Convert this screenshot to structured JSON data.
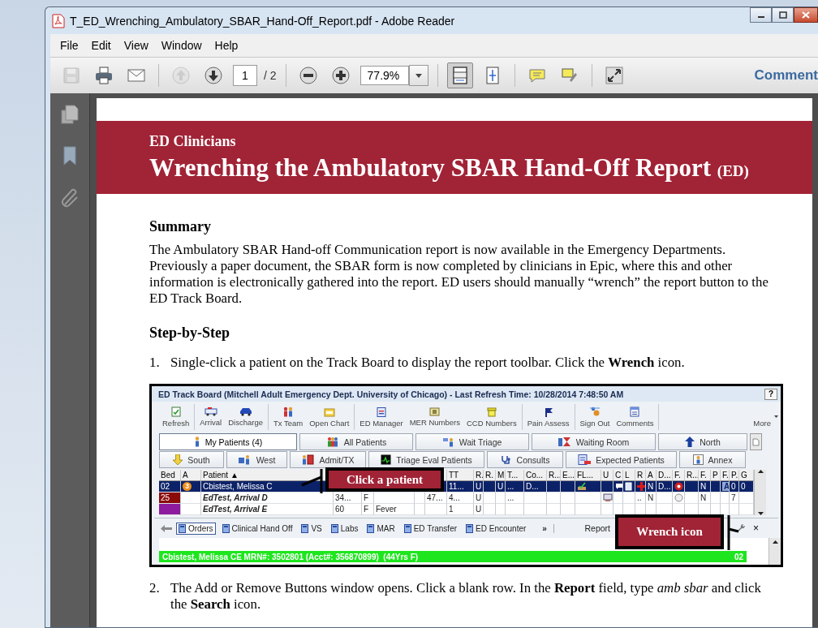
{
  "window": {
    "title": "T_ED_Wrenching_Ambulatory_SBAR_Hand-Off_Report.pdf - Adobe Reader"
  },
  "menu": [
    "File",
    "Edit",
    "View",
    "Window",
    "Help"
  ],
  "toolbar": {
    "save": {
      "disabled": true
    },
    "previous_page": {
      "disabled": true
    },
    "page": "1",
    "page_total": "/ 2",
    "zoom": "77.9%",
    "fit_page": {
      "selected": true
    },
    "fit_window": {
      "selected": false
    },
    "comment_label": "Comment"
  },
  "document": {
    "kicker": "ED Clinicians",
    "title": "Wrenching the Ambulatory SBAR Hand-Off Report",
    "title_suffix": "(ED)",
    "summary_heading": "Summary",
    "summary": "The Ambulatory SBAR Hand-off Communication report is now available in the Emergency Departments. Previously a paper document, the SBAR form is now completed by clinicians in Epic, where this and other information is electronically gathered into the report.  ED users should manually “wrench” the report button to the ED Track Board.",
    "steps_heading": "Step-by-Step",
    "steps": [
      {
        "number": "1.",
        "text": "Single-click a patient on the Track Board to display the report toolbar.  Click the **Wrench** icon.",
        "track_board": {
          "title": "ED Track Board (Mitchell Adult Emergency Dept. University of Chicago) - Last Refresh Time: 10/28/2014 7:48:50 AM",
          "help": "?",
          "toolbar_groups": [
            [
              "Refresh"
            ],
            [
              "Arrival",
              "Discharge"
            ],
            [
              "Tx Team",
              "Open Chart"
            ],
            [
              "ED Manager",
              "MER Numbers",
              "CCD Numbers"
            ],
            [
              "Pain Assess"
            ],
            [
              "Sign Out",
              "Comments"
            ]
          ],
          "more": "More",
          "tab_rows": [
            [
              {
                "label": "My Patients (4)",
                "selected": true
              },
              {
                "label": "All Patients",
                "selected": false
              },
              {
                "label": "Wait Triage",
                "selected": false
              },
              {
                "label": "Waiting Room",
                "selected": false
              },
              {
                "label": "North",
                "selected": false
              }
            ],
            [
              {
                "label": "South",
                "selected": false
              },
              {
                "label": "West",
                "selected": false
              },
              {
                "label": "Admit/TX",
                "selected": false
              },
              {
                "label": "Triage Eval Patients",
                "selected": false
              },
              {
                "label": "Consults",
                "selected": false
              },
              {
                "label": "Expected Patients",
                "selected": false
              },
              {
                "label": "Annex",
                "selected": false
              }
            ]
          ],
          "columns": [
            "Bed",
            "A",
            "Patient ▲",
            null,
            null,
            null,
            null,
            null,
            "TT",
            "R.",
            "R.",
            "M",
            "T...",
            "Co...",
            "R...",
            "E...",
            "FL...",
            "U",
            "C",
            "L",
            "R",
            "A",
            "D...",
            "F.",
            "R...",
            "F.",
            "P",
            "F.",
            "P.",
            "G"
          ],
          "rows": [
            {
              "selected": true,
              "italic": false,
              "cells": [
                "02",
                {
                  "kind": "badge",
                  "text": "3"
                },
                "Cbistest, Melissa C",
                null,
                null,
                null,
                null,
                null,
                "11...",
                "U",
                null,
                "U",
                "...",
                "D...",
                null,
                null,
                {
                  "kind": "check"
                },
                null,
                {
                  "kind": "bubble"
                },
                {
                  "kind": "note"
                },
                {
                  "kind": "cross"
                },
                "N",
                "D...",
                {
                  "kind": "alert"
                },
                null,
                "N",
                null,
                {
                  "kind": "boxed",
                  "text": "A"
                },
                "0",
                "0"
              ]
            },
            {
              "selected": false,
              "italic": true,
              "color": "#8b0a0a",
              "cells": [
                "25",
                null,
                "EdTest, Arrival D",
                "34...",
                "F",
                null,
                null,
                "47...",
                "4...",
                "U",
                null,
                null,
                "...",
                null,
                null,
                null,
                null,
                {
                  "kind": "monitor"
                },
                null,
                null,
                "..",
                "N",
                null,
                {
                  "kind": "circle"
                },
                null,
                "N",
                null,
                null,
                "7",
                null
              ]
            },
            {
              "selected": false,
              "italic": true,
              "color": "#8e1a9e",
              "cells": [
                null,
                null,
                "EdTest, Arrival E",
                "60",
                "F",
                "Fever",
                null,
                null,
                "1",
                "U",
                null,
                null,
                null,
                null,
                null,
                null,
                null,
                null,
                null,
                null,
                null,
                null,
                null,
                null,
                null,
                null,
                null,
                null,
                null,
                null
              ]
            }
          ],
          "tools": [
            {
              "label": "Orders",
              "selected": true
            },
            {
              "label": "Clinical Hand Off",
              "selected": false
            },
            {
              "label": "VS",
              "selected": false
            },
            {
              "label": "Labs",
              "selected": false
            },
            {
              "label": "MAR",
              "selected": false
            },
            {
              "label": "ED Transfer",
              "selected": false
            },
            {
              "label": "ED Encounter",
              "selected": false
            }
          ],
          "overflow": "»",
          "report": "Report",
          "close": "×",
          "patient": "Cbistest, Melissa CE MRN#: 3502801 (Acct#: 356870899)  (44Yrs F)",
          "patient_bed": "02",
          "callouts": [
            {
              "text": "Click a patient"
            },
            {
              "text": "Wrench icon"
            }
          ]
        }
      },
      {
        "number": "2.",
        "text": "The Add or Remove Buttons window opens.  Click a blank row.  In the **Report** field, type *amb sbar* and click the **Search** icon."
      }
    ]
  }
}
